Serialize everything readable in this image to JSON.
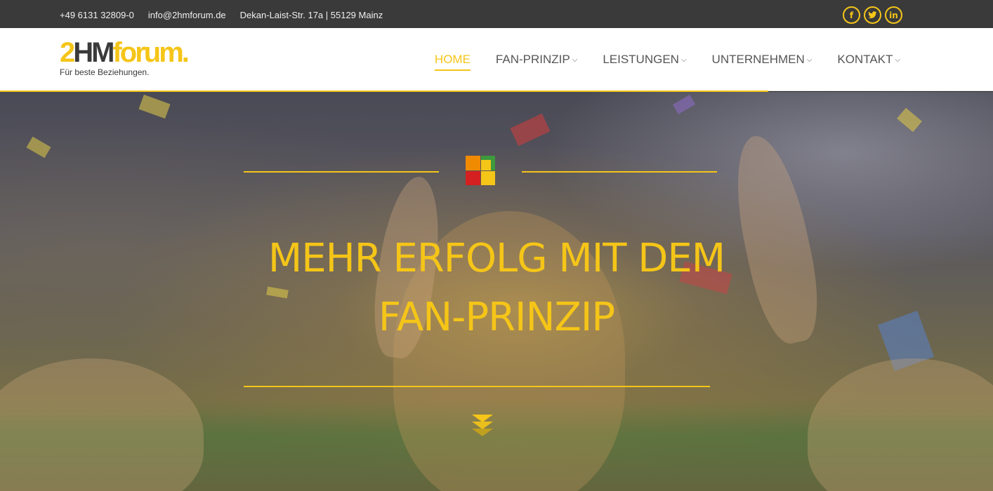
{
  "topbar": {
    "phone": "+49 6131 32809-0",
    "email": "info@2hmforum.de",
    "address": "Dekan-Laist-Str. 17a | 55129 Mainz",
    "social": [
      {
        "icon": "facebook-icon",
        "glyph": "f"
      },
      {
        "icon": "twitter-icon",
        "glyph": ""
      },
      {
        "icon": "linkedin-icon",
        "glyph": "in"
      }
    ]
  },
  "header": {
    "logo": {
      "wordmark_part1": "2",
      "wordmark_part2": "HM",
      "wordmark_part3": "forum.",
      "tagline": "Für beste Beziehungen."
    },
    "nav": [
      {
        "label": "HOME",
        "active": true,
        "dropdown": false
      },
      {
        "label": "FAN-PRINZIP",
        "active": false,
        "dropdown": true
      },
      {
        "label": "LEISTUNGEN",
        "active": false,
        "dropdown": true
      },
      {
        "label": "UNTERNEHMEN",
        "active": false,
        "dropdown": true
      },
      {
        "label": "KONTAKT",
        "active": false,
        "dropdown": true
      }
    ]
  },
  "hero": {
    "headline_line1": "MEHR ERFOLG MIT DEM",
    "headline_line2": "FAN-PRINZIP",
    "emblem_colors": [
      "#f08a00",
      "#4caf50",
      "#d42020",
      "#f5c518"
    ],
    "accent_color": "#f5c518"
  },
  "colors": {
    "brand_yellow": "#f5c518",
    "topbar_bg": "#3a3a3a",
    "nav_text": "#555555"
  }
}
